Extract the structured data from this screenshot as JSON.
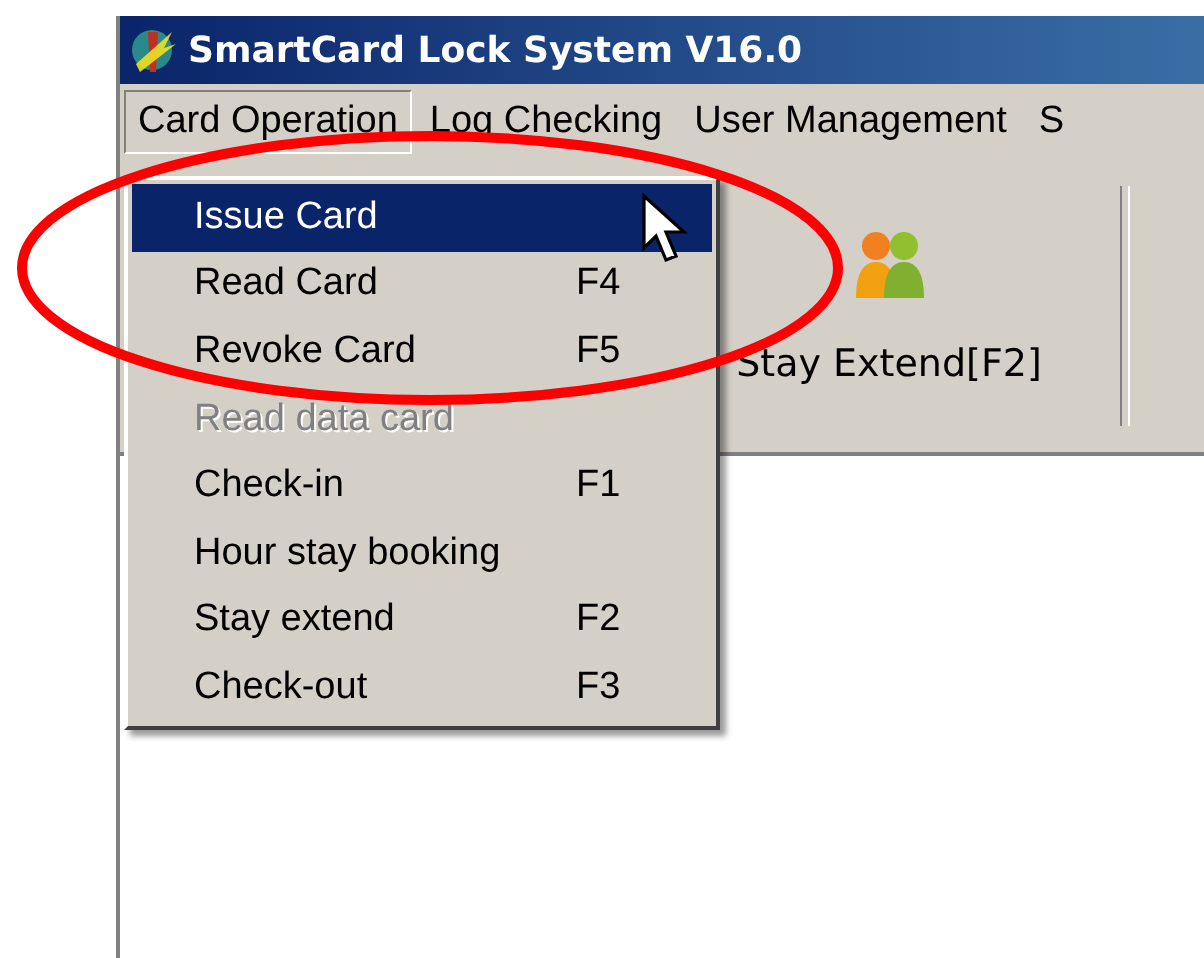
{
  "window": {
    "title": "SmartCard Lock System V16.0"
  },
  "menu_bar": [
    {
      "label": "Card Operation",
      "selected": true
    },
    {
      "label": "Log Checking",
      "selected": false
    },
    {
      "label": "User Management",
      "selected": false
    },
    {
      "label": "S",
      "selected": false
    }
  ],
  "dropdown": [
    {
      "label": "Issue Card",
      "selected": true,
      "disabled": false
    },
    {
      "label": "Read Card",
      "shortcut": "F4",
      "selected": false,
      "disabled": false
    },
    {
      "label": "Revoke Card",
      "shortcut": "F5",
      "selected": false,
      "disabled": false
    },
    {
      "label": "Read data card",
      "selected": false,
      "disabled": true
    },
    {
      "label": "Check-in",
      "shortcut": "F1",
      "selected": false,
      "disabled": false
    },
    {
      "label": "Hour stay booking",
      "selected": false,
      "disabled": false
    },
    {
      "label": "Stay extend",
      "shortcut": "F2",
      "selected": false,
      "disabled": false
    },
    {
      "label": "Check-out",
      "shortcut": "F3",
      "selected": false,
      "disabled": false
    }
  ],
  "toolbar": [
    {
      "label": "Stay Extend[F2]"
    }
  ]
}
